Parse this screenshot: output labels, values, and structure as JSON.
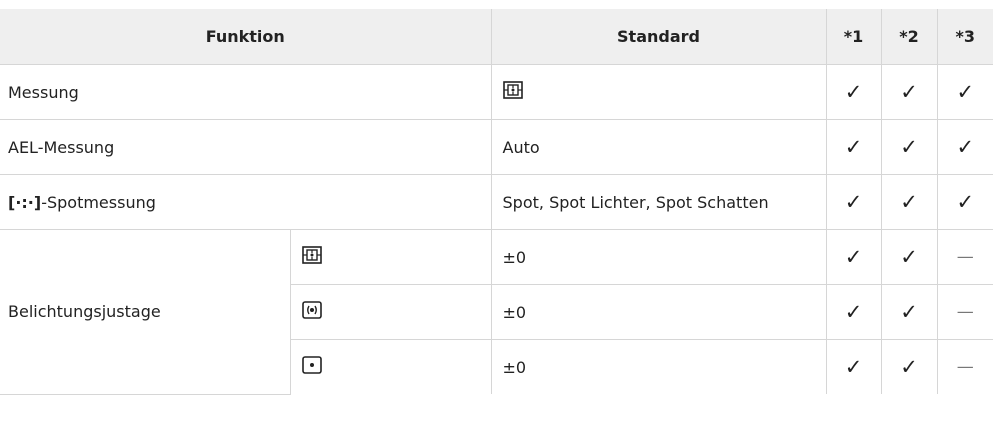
{
  "table": {
    "headers": {
      "funktion": "Funktion",
      "standard": "Standard",
      "c1": "*1",
      "c2": "*2",
      "c3": "*3"
    },
    "rows": [
      {
        "label": "Messung",
        "standard_icon": "esp-metering-icon",
        "c1": "✓",
        "c2": "✓",
        "c3": "✓"
      },
      {
        "label": "AEL-Messung",
        "standard": "Auto",
        "c1": "✓",
        "c2": "✓",
        "c3": "✓"
      },
      {
        "label_icon_text": "[·:·]",
        "label": "-Spotmessung",
        "standard": "Spot, Spot Lichter, Spot Schatten",
        "c1": "✓",
        "c2": "✓",
        "c3": "✓"
      }
    ],
    "group": {
      "label": "Belichtungsjustage",
      "subrows": [
        {
          "icon": "esp-metering-icon",
          "standard": "±0",
          "c1": "✓",
          "c2": "✓",
          "c3": "—"
        },
        {
          "icon": "center-weighted-metering-icon",
          "standard": "±0",
          "c1": "✓",
          "c2": "✓",
          "c3": "—"
        },
        {
          "icon": "spot-metering-icon",
          "standard": "±0",
          "c1": "✓",
          "c2": "✓",
          "c3": "—"
        }
      ]
    }
  }
}
